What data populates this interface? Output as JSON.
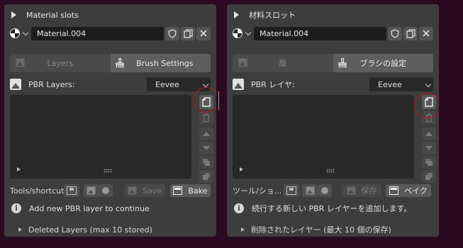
{
  "panels": [
    {
      "header_title": "Material slots",
      "material_name": "Material.004",
      "tab_layers": "Layers",
      "tab_brush": "Brush Settings",
      "pbr_label": "PBR Layers:",
      "engine": "Eevee",
      "tools_label": "Tools/shortcuts:",
      "save_label": "Save",
      "bake_label": "Bake",
      "info_text": "Add new PBR layer to continue",
      "deleted_label": "Deleted Layers (max 10 stored)"
    },
    {
      "header_title": "材料スロット",
      "material_name": "Material.004",
      "tab_layers": "層",
      "tab_brush": "ブラシの設定",
      "pbr_label": "PBR レイヤ:",
      "engine": "Eevee",
      "tools_label": "ツール/ショ...",
      "save_label": "保存",
      "bake_label": "ベイク",
      "info_text": "続行する新しい PBR レイヤーを追加します。",
      "deleted_label": "削除されたレイヤー (最大 10 個の保存)"
    }
  ],
  "colors": {
    "background": "#2b0a1f",
    "panel": "#3d3d3d",
    "highlight_circle": "#c41414"
  },
  "icons": [
    "expand-triangle-icon",
    "material-sphere-icon",
    "fake-user-shield-icon",
    "duplicate-icon",
    "close-icon",
    "image-icon",
    "brush-icon",
    "add-layer-icon",
    "trash-icon",
    "arrow-up-icon",
    "arrow-down-icon",
    "info-icon"
  ]
}
